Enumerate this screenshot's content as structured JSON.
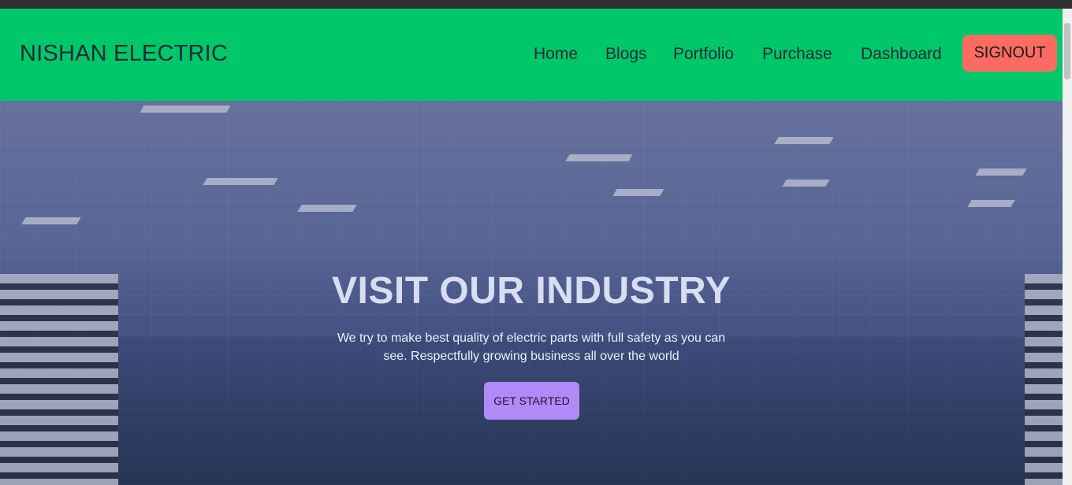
{
  "nav": {
    "brand": "NISHAN ELECTRIC",
    "links": [
      "Home",
      "Blogs",
      "Portfolio",
      "Purchase",
      "Dashboard"
    ],
    "signout_label": "SIGNOUT"
  },
  "hero": {
    "title": "VISIT OUR INDUSTRY",
    "subtitle": "We try to make best quality of electric parts with full safety as you can see. Respectfully growing business all over the world",
    "cta_label": "GET STARTED"
  },
  "colors": {
    "navbar": "#00c76a",
    "signout": "#fb6b62",
    "cta": "#b388f7"
  }
}
